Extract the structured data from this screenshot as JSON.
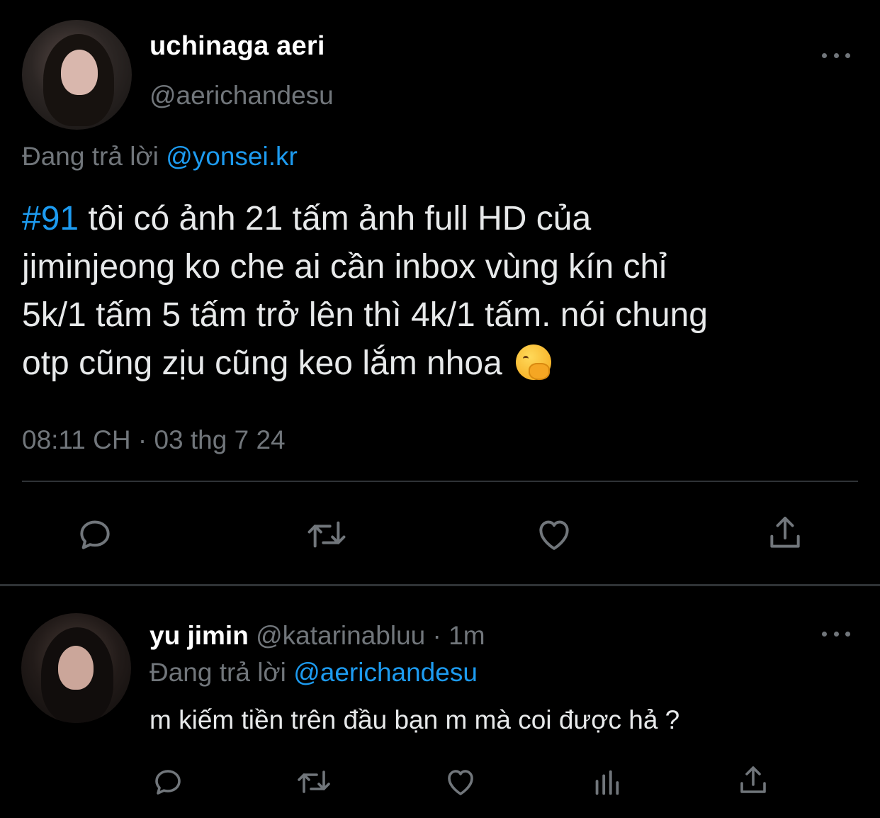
{
  "colors": {
    "background": "#000000",
    "text_primary": "#e7e9ea",
    "text_secondary": "#71767b",
    "accent": "#1d9bf0",
    "divider": "#2f3336"
  },
  "main_tweet": {
    "author": {
      "display_name": "uchinaga aeri",
      "handle": "@aerichandesu",
      "avatar": "profile-photo"
    },
    "replying_prefix": "Đang trả lời",
    "replying_to": "@yonsei.kr",
    "text": {
      "hashtag": "#91",
      "line1": " tôi có ảnh 21 tấm ảnh full HD của",
      "line2": "jiminjeong ko che ai cần inbox vùng kín chỉ",
      "line3": "5k/1 tấm 5 tấm trở lên thì 4k/1 tấm. nói chung",
      "line4": "otp cũng zịu cũng keo lắm nhoa",
      "emoji": "face-with-hand-over-mouth"
    },
    "timestamp": "08:11 CH · 03 thg 7 24",
    "actions": [
      "reply-icon",
      "retweet-icon",
      "like-icon",
      "share-icon"
    ]
  },
  "reply_tweet": {
    "author": {
      "display_name": "yu jimin",
      "handle": "@katarinabluu",
      "separator": " · ",
      "time": "1m",
      "avatar": "profile-photo"
    },
    "replying_prefix": "Đang trả lời",
    "replying_to": "@aerichandesu",
    "text": "m kiếm tiền trên đầu bạn m mà coi được hả ?",
    "actions": [
      "reply-icon",
      "retweet-icon",
      "like-icon",
      "analytics-icon",
      "share-icon"
    ]
  }
}
